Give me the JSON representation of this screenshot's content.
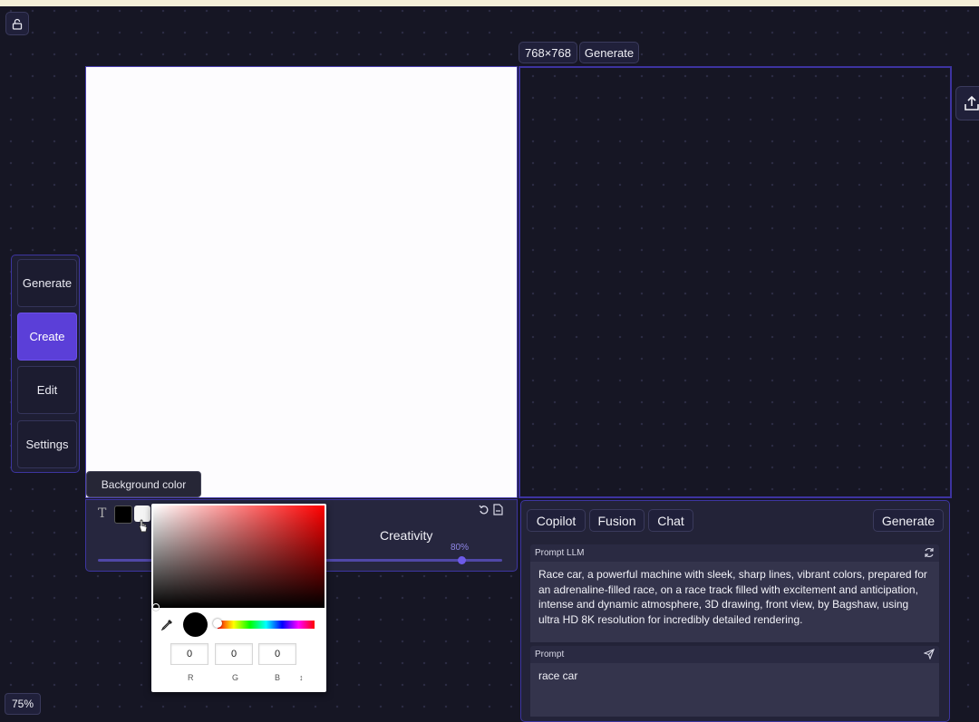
{
  "canvas": {
    "size_label": "768×768",
    "generate_label": "Generate"
  },
  "sidebar": {
    "items": [
      {
        "label": "Generate",
        "active": false
      },
      {
        "label": "Create",
        "active": true
      },
      {
        "label": "Edit",
        "active": false
      },
      {
        "label": "Settings",
        "active": false
      }
    ]
  },
  "tools": {
    "tooltip": "Background color",
    "text_tool": "T",
    "creativity_label": "Creativity",
    "creativity_value": "80%",
    "creativity_fraction": 0.9
  },
  "color_picker": {
    "r": "0",
    "g": "0",
    "b": "0",
    "r_label": "R",
    "g_label": "G",
    "b_label": "B",
    "extra_label": "↕"
  },
  "right_panel": {
    "tabs": [
      "Copilot",
      "Fusion",
      "Chat"
    ],
    "generate_label": "Generate",
    "prompt_llm_label": "Prompt LLM",
    "prompt_llm_text": "Race car, a powerful machine with sleek, sharp lines, vibrant colors, prepared for an adrenaline-filled race, on a race track filled with excitement and anticipation, intense and dynamic atmosphere, 3D drawing, front view, by Bagshaw, using ultra HD 8K resolution for incredibly detailed rendering.",
    "prompt_label": "Prompt",
    "prompt_text": "race car"
  },
  "zoom": "75%",
  "colors": {
    "accent": "#5b3fd8",
    "border": "#3d35a0"
  }
}
